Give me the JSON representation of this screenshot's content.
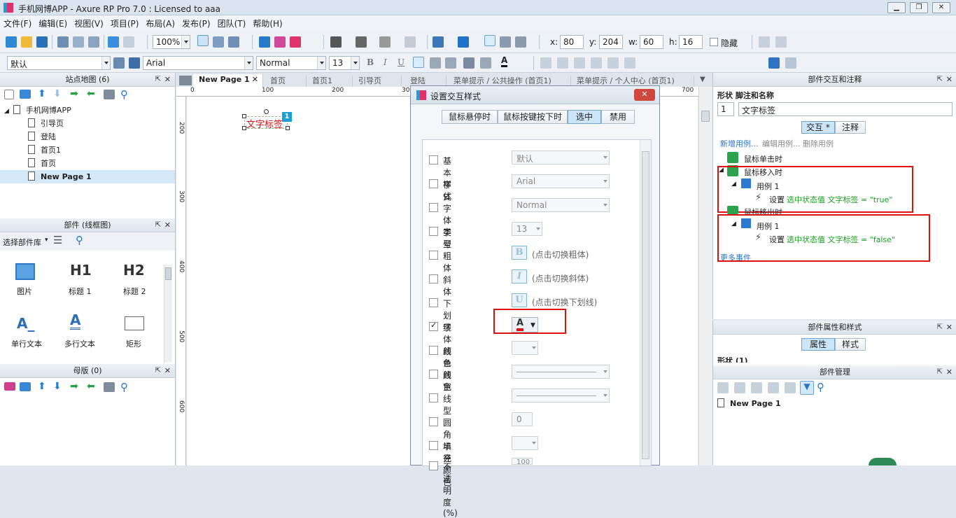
{
  "app": {
    "title": "手机网博APP - Axure RP Pro 7.0 : Licensed to aaa"
  },
  "menu": [
    "文件(F)",
    "编辑(E)",
    "视图(V)",
    "项目(P)",
    "布局(A)",
    "发布(P)",
    "团队(T)",
    "帮助(H)"
  ],
  "toolbar": {
    "zoom": "100%",
    "x_label": "x:",
    "x": "80",
    "y_label": "y:",
    "y": "204",
    "w_label": "w:",
    "w": "60",
    "h_label": "h:",
    "h": "16",
    "hidden_label": "隐藏"
  },
  "format_bar": {
    "style": "默认",
    "font": "Arial",
    "weight": "Normal",
    "size": "13"
  },
  "sitemap": {
    "title": "站点地图 (6)",
    "root": "手机网博APP",
    "pages": [
      "引导页",
      "登陆",
      "首页1",
      "首页",
      "New Page 1"
    ],
    "selected": "New Page 1"
  },
  "widgets": {
    "title": "部件 (线框图)",
    "library_label": "选择部件库",
    "items": [
      {
        "glyph": "H1",
        "label": "标题 1"
      },
      {
        "glyph": "H2",
        "label": "标题 2"
      },
      {
        "label": "图片"
      },
      {
        "label": "单行文本"
      },
      {
        "label": "多行文本"
      },
      {
        "label": "矩形"
      }
    ]
  },
  "masters": {
    "title": "母版 (0)"
  },
  "tabs": [
    "New Page 1",
    "首页",
    "首页1",
    "引导页",
    "登陆",
    "菜单提示 / 公共操作 (首页1)",
    "菜单提示 / 个人中心 (首页1)"
  ],
  "ruler": {
    "h": [
      "0",
      "100",
      "200",
      "300",
      "400",
      "500",
      "600",
      "700"
    ],
    "v": [
      "200",
      "300",
      "400",
      "500",
      "600"
    ]
  },
  "canvas": {
    "label_text": "文字标签",
    "badge": "1"
  },
  "dialog": {
    "title": "设置交互样式",
    "tabs": [
      "鼠标悬停时",
      "鼠标按键按下时",
      "选中",
      "禁用"
    ],
    "active_tab": "选中",
    "rows": [
      {
        "label": "基本样式",
        "value": "默认",
        "checked": false
      },
      {
        "label": "字体",
        "value": "Arial",
        "checked": false
      },
      {
        "label": "字体类型",
        "value": "Normal",
        "checked": false
      },
      {
        "label": "字号",
        "value": "13",
        "checked": false
      },
      {
        "label": "粗体",
        "toggle": "B",
        "hint": "(点击切换粗体)",
        "checked": false
      },
      {
        "label": "斜体",
        "toggle": "I",
        "hint": "(点击切换斜体)",
        "checked": false
      },
      {
        "label": "下划线",
        "toggle": "U",
        "hint": "(点击切换下划线)",
        "checked": false
      },
      {
        "label": "字体颜色",
        "checked": true
      },
      {
        "label": "线条颜色",
        "checked": false
      },
      {
        "label": "线宽",
        "checked": false
      },
      {
        "label": "线型",
        "checked": false
      },
      {
        "label": "圆角半径",
        "value": "0",
        "checked": false
      },
      {
        "label": "填充颜色",
        "checked": false
      },
      {
        "label": "不透明度 (%)",
        "value": "100",
        "checked": false
      }
    ]
  },
  "interactions": {
    "title": "部件交互和注释",
    "shape_label": "形状 脚注和名称",
    "footnote": "1",
    "name": "文字标签",
    "tabs": [
      "交互 *",
      "注释"
    ],
    "links": [
      "新增用例...",
      "编辑用例...",
      "删除用例"
    ],
    "events": [
      {
        "name": "鼠标单击时"
      },
      {
        "name": "鼠标移入时",
        "case": "用例 1",
        "action": "设置",
        "detail": "选中状态值 文字标签 = \"true\""
      },
      {
        "name": "鼠标移出时",
        "case": "用例 1",
        "action": "设置",
        "detail": "选中状态值 文字标签 = \"false\""
      }
    ],
    "more": "更多事件"
  },
  "properties": {
    "title": "部件属性和样式",
    "tabs": [
      "属性",
      "样式"
    ],
    "section": "形状 (1)"
  },
  "manager": {
    "title": "部件管理",
    "page": "New Page 1"
  },
  "colors": {
    "accent": "#19a0d8",
    "red_box": "#e01010",
    "green": "#19a01e",
    "font_red": "#e01010"
  }
}
